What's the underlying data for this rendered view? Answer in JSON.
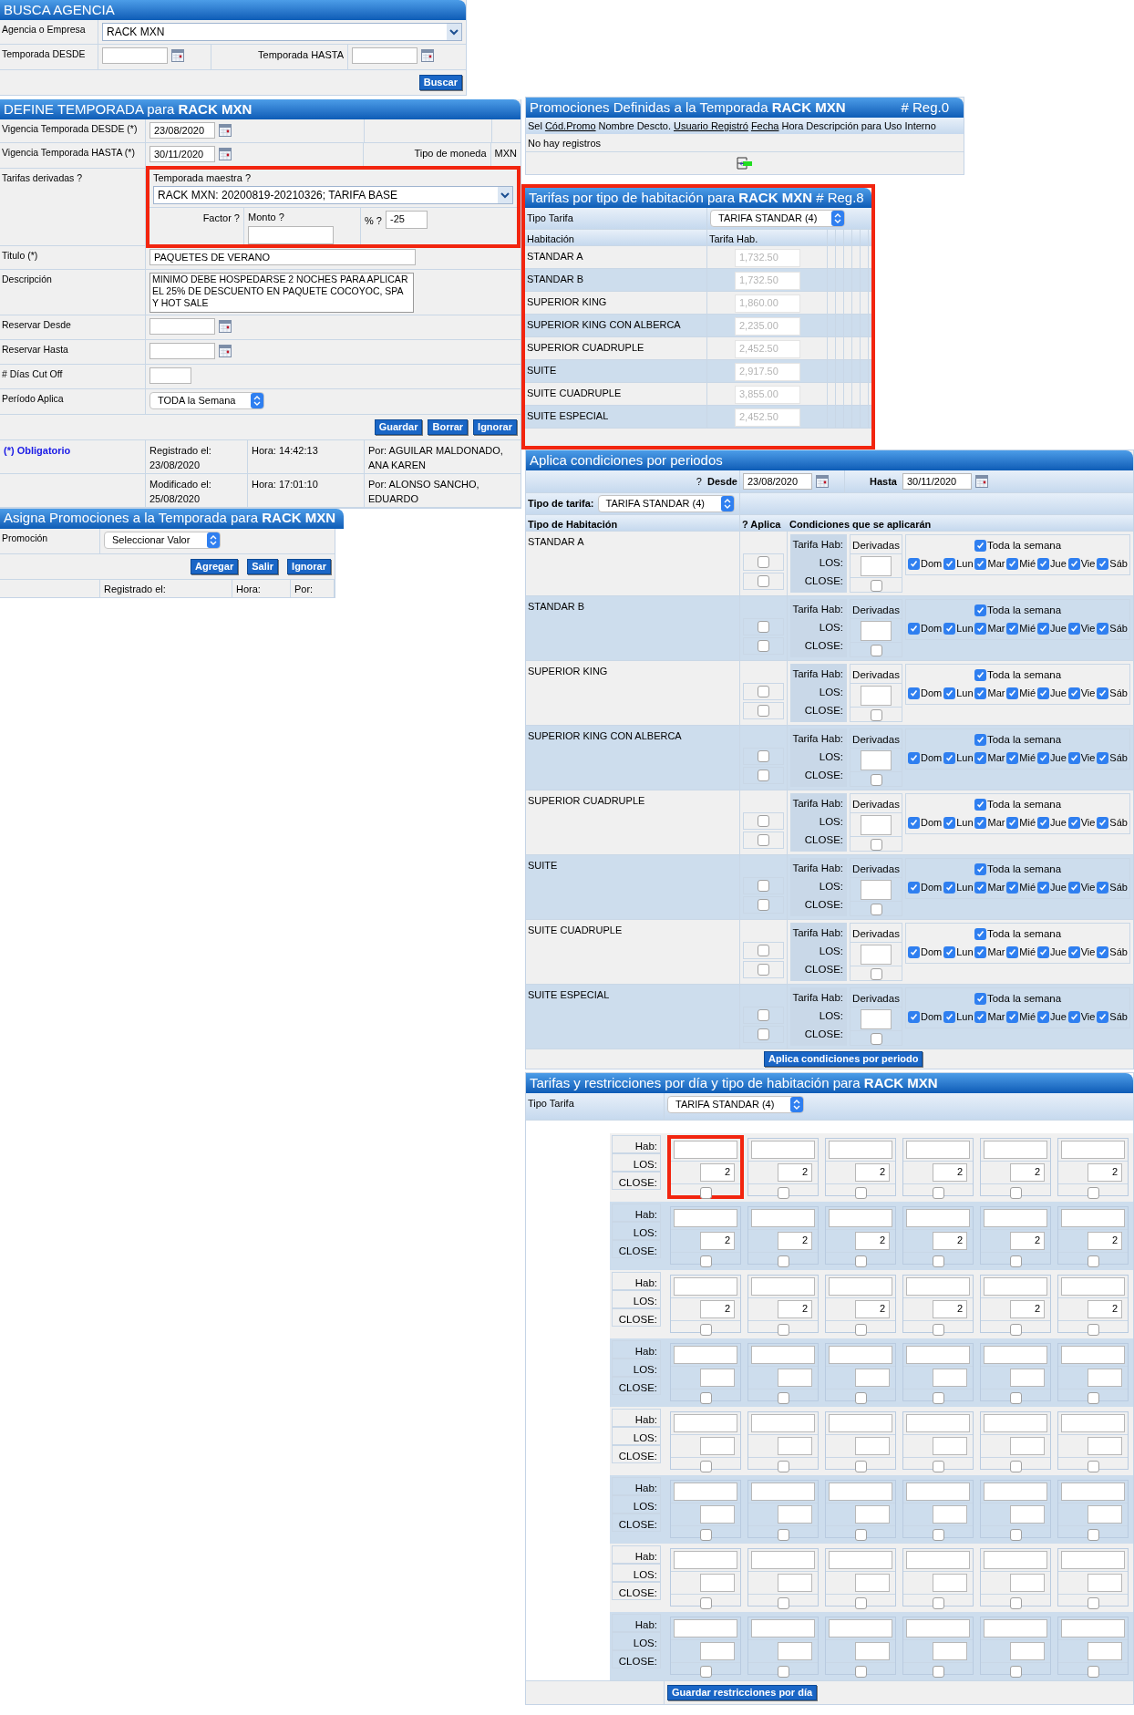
{
  "busca_agencia": {
    "title": "BUSCA AGENCIA",
    "agency_label": "Agencia o Empresa",
    "agency_value": "RACK MXN",
    "desde_label": "Temporada DESDE",
    "hasta_label": "Temporada HASTA",
    "button": "Buscar"
  },
  "define_temporada": {
    "title": "DEFINE TEMPORADA para **RACK MXN**",
    "desde_label": "Vigencia Temporada DESDE (*)",
    "desde_value": "23/08/2020",
    "hasta_label": "Vigencia Temporada HASTA (*)",
    "hasta_value": "30/11/2020",
    "moneda_label": "Tipo de moneda",
    "moneda_value": "MXN",
    "derivadas_label": "Tarifas derivadas ?",
    "maestra": {
      "highlighted": true,
      "label": "Temporada maestra ?",
      "value": "RACK MXN: 20200819-20210326; TARIFA BASE",
      "factor_label": "Factor ?",
      "monto_label": "Monto ?",
      "pct_label": "% ?",
      "pct_value": "-25"
    },
    "titulo_label": "Titulo (*)",
    "titulo_value": "PAQUETES DE VERANO",
    "descripcion_label": "Descripción",
    "descripcion_value": "MINIMO DEBE HOSPEDARSE 2 NOCHES PARA APLICAR EL 25% DE DESCUENTO EN PAQUETE COCOYOC, SPA Y HOT SALE",
    "reservar_desde_label": "Reservar Desde",
    "reservar_hasta_label": "Reservar Hasta",
    "cutoff_label": "# Días Cut Off",
    "periodo_label": "Período Aplica",
    "periodo_value": "TODA la Semana",
    "buttons": [
      "Guardar",
      "Borrar",
      "Ignorar"
    ],
    "obligatorio": "(*) Obligatorio",
    "audit": [
      {
        "date": "Registrado el: 23/08/2020",
        "time": "Hora: 14:42:13",
        "by": "Por: AGUILAR MALDONADO, ANA KAREN"
      },
      {
        "date": "Modificado el: 25/08/2020",
        "time": "Hora: 17:01:10",
        "by": "Por: ALONSO SANCHO, EDUARDO"
      }
    ]
  },
  "asigna_promociones": {
    "title": "Asigna Promociones a la Temporada para **RACK MXN**",
    "promocion_label": "Promoción",
    "promocion_value": "Seleccionar Valor",
    "buttons": [
      "Agregar",
      "Salir",
      "Ignorar"
    ],
    "footer": [
      "Registrado el:",
      "Hora:",
      "Por:"
    ]
  },
  "promociones": {
    "title": "Promociones Definidas a la Temporada **RACK MXN**",
    "count": "# Reg.0",
    "columns": [
      {
        "label": "Sel",
        "underlined": false
      },
      {
        "label": "Cód.Promo",
        "underlined": true
      },
      {
        "label": "Nombre",
        "underlined": false
      },
      {
        "label": "Descto.",
        "underlined": false
      },
      {
        "label": "Usuario Registró",
        "underlined": true
      },
      {
        "label": "Fecha",
        "underlined": true
      },
      {
        "label": "Hora",
        "underlined": false
      },
      {
        "label": "Descripción para Uso Interno",
        "underlined": false
      }
    ],
    "empty": "No hay registros"
  },
  "tarifas": {
    "highlighted": true,
    "title": "Tarifas por tipo de habitación para **RACK MXN** # Reg.8",
    "tipo_label": "Tipo Tarifa",
    "tipo_value": "TARIFA STANDAR (4)",
    "columns": [
      "Habitación",
      "Tarifa Hab."
    ],
    "rates_disabled": true,
    "rows": [
      {
        "name": "STANDAR A",
        "rate": "1,732.50"
      },
      {
        "name": "STANDAR B",
        "rate": "1,732.50"
      },
      {
        "name": "SUPERIOR KING",
        "rate": "1,860.00"
      },
      {
        "name": "SUPERIOR KING CON ALBERCA",
        "rate": "2,235.00"
      },
      {
        "name": "SUPERIOR CUADRUPLE",
        "rate": "2,452.50"
      },
      {
        "name": "SUITE",
        "rate": "2,917.50"
      },
      {
        "name": "SUITE CUADRUPLE",
        "rate": "3,855.00"
      },
      {
        "name": "SUITE ESPECIAL",
        "rate": "2,452.50"
      }
    ]
  },
  "condiciones": {
    "title": "Aplica condiciones por periodos",
    "desde_mark": "?",
    "desde_label": "Desde",
    "desde_value": "23/08/2020",
    "hasta_label": "Hasta",
    "hasta_value": "30/11/2020",
    "tipo_label": "Tipo de tarifa:",
    "tipo_value": "TARIFA STANDAR (4)",
    "columns": [
      "Tipo de Habitación",
      "? Aplica",
      "Condiciones que se aplicarán"
    ],
    "button": "Aplica condiciones por periodo",
    "rooms": [
      {
        "name": "STANDAR A",
        "aplica": [
          false,
          false
        ],
        "labels": [
          "Tarifa Hab:",
          "LOS:",
          "CLOSE:"
        ],
        "derivadas": "Derivadas",
        "derivada_close": false,
        "week": {
          "label": "Toda la semana",
          "checked": true
        },
        "days": [
          {
            "label": "Dom",
            "checked": true
          },
          {
            "label": "Lun",
            "checked": true
          },
          {
            "label": "Mar",
            "checked": true
          },
          {
            "label": "Mié",
            "checked": true
          },
          {
            "label": "Jue",
            "checked": true
          },
          {
            "label": "Vie",
            "checked": true
          },
          {
            "label": "Sáb",
            "checked": true
          }
        ]
      },
      {
        "name": "STANDAR B",
        "aplica": [
          false,
          false
        ],
        "labels": [
          "Tarifa Hab:",
          "LOS:",
          "CLOSE:"
        ],
        "derivadas": "Derivadas",
        "derivada_close": false,
        "week": {
          "label": "Toda la semana",
          "checked": true
        },
        "days": [
          {
            "label": "Dom",
            "checked": true
          },
          {
            "label": "Lun",
            "checked": true
          },
          {
            "label": "Mar",
            "checked": true
          },
          {
            "label": "Mié",
            "checked": true
          },
          {
            "label": "Jue",
            "checked": true
          },
          {
            "label": "Vie",
            "checked": true
          },
          {
            "label": "Sáb",
            "checked": true
          }
        ]
      },
      {
        "name": "SUPERIOR KING",
        "aplica": [
          false,
          false
        ],
        "labels": [
          "Tarifa Hab:",
          "LOS:",
          "CLOSE:"
        ],
        "derivadas": "Derivadas",
        "derivada_close": false,
        "week": {
          "label": "Toda la semana",
          "checked": true
        },
        "days": [
          {
            "label": "Dom",
            "checked": true
          },
          {
            "label": "Lun",
            "checked": true
          },
          {
            "label": "Mar",
            "checked": true
          },
          {
            "label": "Mié",
            "checked": true
          },
          {
            "label": "Jue",
            "checked": true
          },
          {
            "label": "Vie",
            "checked": true
          },
          {
            "label": "Sáb",
            "checked": true
          }
        ]
      },
      {
        "name": "SUPERIOR KING CON ALBERCA",
        "aplica": [
          false,
          false
        ],
        "labels": [
          "Tarifa Hab:",
          "LOS:",
          "CLOSE:"
        ],
        "derivadas": "Derivadas",
        "derivada_close": false,
        "week": {
          "label": "Toda la semana",
          "checked": true
        },
        "days": [
          {
            "label": "Dom",
            "checked": true
          },
          {
            "label": "Lun",
            "checked": true
          },
          {
            "label": "Mar",
            "checked": true
          },
          {
            "label": "Mié",
            "checked": true
          },
          {
            "label": "Jue",
            "checked": true
          },
          {
            "label": "Vie",
            "checked": true
          },
          {
            "label": "Sáb",
            "checked": true
          }
        ]
      },
      {
        "name": "SUPERIOR CUADRUPLE",
        "aplica": [
          false,
          false
        ],
        "labels": [
          "Tarifa Hab:",
          "LOS:",
          "CLOSE:"
        ],
        "derivadas": "Derivadas",
        "derivada_close": false,
        "week": {
          "label": "Toda la semana",
          "checked": true
        },
        "days": [
          {
            "label": "Dom",
            "checked": true
          },
          {
            "label": "Lun",
            "checked": true
          },
          {
            "label": "Mar",
            "checked": true
          },
          {
            "label": "Mié",
            "checked": true
          },
          {
            "label": "Jue",
            "checked": true
          },
          {
            "label": "Vie",
            "checked": true
          },
          {
            "label": "Sáb",
            "checked": true
          }
        ]
      },
      {
        "name": "SUITE",
        "aplica": [
          false,
          false
        ],
        "labels": [
          "Tarifa Hab:",
          "LOS:",
          "CLOSE:"
        ],
        "derivadas": "Derivadas",
        "derivada_close": false,
        "week": {
          "label": "Toda la semana",
          "checked": true
        },
        "days": [
          {
            "label": "Dom",
            "checked": true
          },
          {
            "label": "Lun",
            "checked": true
          },
          {
            "label": "Mar",
            "checked": true
          },
          {
            "label": "Mié",
            "checked": true
          },
          {
            "label": "Jue",
            "checked": true
          },
          {
            "label": "Vie",
            "checked": true
          },
          {
            "label": "Sáb",
            "checked": true
          }
        ]
      },
      {
        "name": "SUITE CUADRUPLE",
        "aplica": [
          false,
          false
        ],
        "labels": [
          "Tarifa Hab:",
          "LOS:",
          "CLOSE:"
        ],
        "derivadas": "Derivadas",
        "derivada_close": false,
        "week": {
          "label": "Toda la semana",
          "checked": true
        },
        "days": [
          {
            "label": "Dom",
            "checked": true
          },
          {
            "label": "Lun",
            "checked": true
          },
          {
            "label": "Mar",
            "checked": true
          },
          {
            "label": "Mié",
            "checked": true
          },
          {
            "label": "Jue",
            "checked": true
          },
          {
            "label": "Vie",
            "checked": true
          },
          {
            "label": "Sáb",
            "checked": true
          }
        ]
      },
      {
        "name": "SUITE ESPECIAL",
        "aplica": [
          false,
          false
        ],
        "labels": [
          "Tarifa Hab:",
          "LOS:",
          "CLOSE:"
        ],
        "derivadas": "Derivadas",
        "derivada_close": false,
        "week": {
          "label": "Toda la semana",
          "checked": true
        },
        "days": [
          {
            "label": "Dom",
            "checked": true
          },
          {
            "label": "Lun",
            "checked": true
          },
          {
            "label": "Mar",
            "checked": true
          },
          {
            "label": "Mié",
            "checked": true
          },
          {
            "label": "Jue",
            "checked": true
          },
          {
            "label": "Vie",
            "checked": true
          },
          {
            "label": "Sáb",
            "checked": true
          }
        ]
      }
    ]
  },
  "restricciones": {
    "title": "Tarifas y restricciones por día y tipo de habitación para **RACK MXN**",
    "tipo_label": "Tipo Tarifa",
    "tipo_value": "TARIFA STANDAR (4)",
    "button": "Guardar restricciones por día",
    "rows": [
      {
        "labels": [
          "Hab:",
          "LOS:",
          "CLOSE:"
        ],
        "cells": [
          {
            "los": "2",
            "close": false,
            "highlighted": true
          },
          {
            "los": "2",
            "close": false,
            "highlighted": false
          },
          {
            "los": "2",
            "close": false,
            "highlighted": false
          },
          {
            "los": "2",
            "close": false,
            "highlighted": false
          },
          {
            "los": "2",
            "close": false,
            "highlighted": false
          },
          {
            "los": "2",
            "close": false,
            "highlighted": false
          }
        ]
      },
      {
        "labels": [
          "Hab:",
          "LOS:",
          "CLOSE:"
        ],
        "cells": [
          {
            "los": "2",
            "close": false,
            "highlighted": false
          },
          {
            "los": "2",
            "close": false,
            "highlighted": false
          },
          {
            "los": "2",
            "close": false,
            "highlighted": false
          },
          {
            "los": "2",
            "close": false,
            "highlighted": false
          },
          {
            "los": "2",
            "close": false,
            "highlighted": false
          },
          {
            "los": "2",
            "close": false,
            "highlighted": false
          }
        ]
      },
      {
        "labels": [
          "Hab:",
          "LOS:",
          "CLOSE:"
        ],
        "cells": [
          {
            "los": "2",
            "close": false,
            "highlighted": false
          },
          {
            "los": "2",
            "close": false,
            "highlighted": false
          },
          {
            "los": "2",
            "close": false,
            "highlighted": false
          },
          {
            "los": "2",
            "close": false,
            "highlighted": false
          },
          {
            "los": "2",
            "close": false,
            "highlighted": false
          },
          {
            "los": "2",
            "close": false,
            "highlighted": false
          }
        ]
      },
      {
        "labels": [
          "Hab:",
          "LOS:",
          "CLOSE:"
        ],
        "cells": [
          {
            "close": false,
            "highlighted": false
          },
          {
            "close": false,
            "highlighted": false
          },
          {
            "close": false,
            "highlighted": false
          },
          {
            "close": false,
            "highlighted": false
          },
          {
            "close": false,
            "highlighted": false
          },
          {
            "close": false,
            "highlighted": false
          }
        ]
      },
      {
        "labels": [
          "Hab:",
          "LOS:",
          "CLOSE:"
        ],
        "cells": [
          {
            "close": false,
            "highlighted": false
          },
          {
            "close": false,
            "highlighted": false
          },
          {
            "close": false,
            "highlighted": false
          },
          {
            "close": false,
            "highlighted": false
          },
          {
            "close": false,
            "highlighted": false
          },
          {
            "close": false,
            "highlighted": false
          }
        ]
      },
      {
        "labels": [
          "Hab:",
          "LOS:",
          "CLOSE:"
        ],
        "cells": [
          {
            "close": false,
            "highlighted": false
          },
          {
            "close": false,
            "highlighted": false
          },
          {
            "close": false,
            "highlighted": false
          },
          {
            "close": false,
            "highlighted": false
          },
          {
            "close": false,
            "highlighted": false
          },
          {
            "close": false,
            "highlighted": false
          }
        ]
      },
      {
        "labels": [
          "Hab:",
          "LOS:",
          "CLOSE:"
        ],
        "cells": [
          {
            "close": false,
            "highlighted": false
          },
          {
            "close": false,
            "highlighted": false
          },
          {
            "close": false,
            "highlighted": false
          },
          {
            "close": false,
            "highlighted": false
          },
          {
            "close": false,
            "highlighted": false
          },
          {
            "close": false,
            "highlighted": false
          }
        ]
      },
      {
        "labels": [
          "Hab:",
          "LOS:",
          "CLOSE:"
        ],
        "cells": [
          {
            "close": false,
            "highlighted": false
          },
          {
            "close": false,
            "highlighted": false
          },
          {
            "close": false,
            "highlighted": false
          },
          {
            "close": false,
            "highlighted": false
          },
          {
            "close": false,
            "highlighted": false
          },
          {
            "close": false,
            "highlighted": false
          }
        ]
      }
    ]
  }
}
